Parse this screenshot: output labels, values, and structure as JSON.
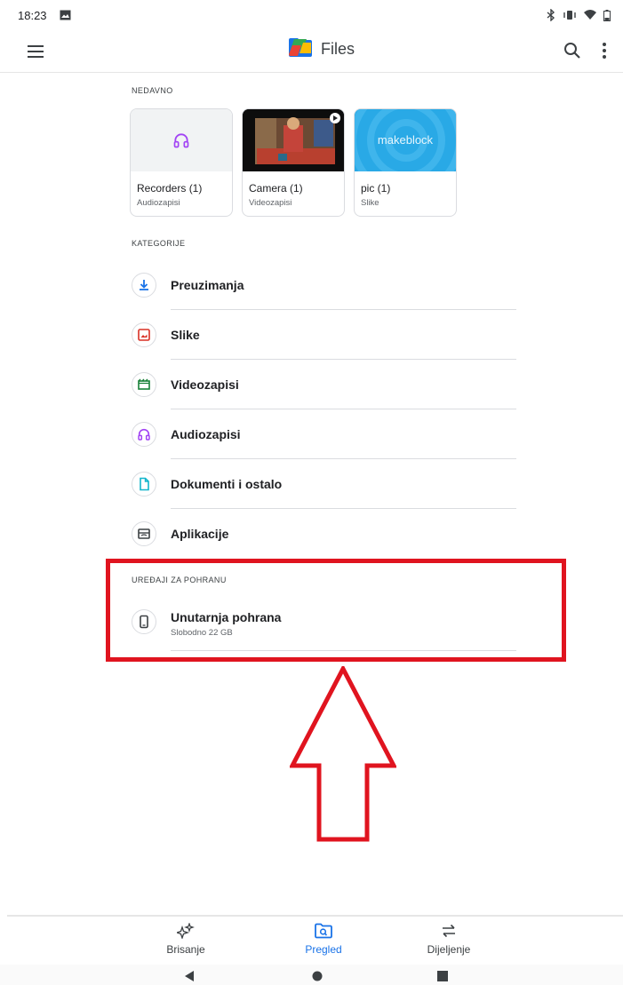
{
  "status_bar": {
    "time": "18:23"
  },
  "app_bar": {
    "title": "Files"
  },
  "recent": {
    "label": "NEDAVNO",
    "cards": [
      {
        "title": "Recorders (1)",
        "subtitle": "Audiozapisi"
      },
      {
        "title": "Camera (1)",
        "subtitle": "Videozapisi"
      },
      {
        "title": "pic (1)",
        "subtitle": "Slike",
        "thumb_text": "makeblock"
      }
    ]
  },
  "categories": {
    "label": "KATEGORIJE",
    "items": [
      {
        "label": "Preuzimanja",
        "icon": "download-icon",
        "color": "#1a73e8"
      },
      {
        "label": "Slike",
        "icon": "image-icon",
        "color": "#d93025"
      },
      {
        "label": "Videozapisi",
        "icon": "video-icon",
        "color": "#188038"
      },
      {
        "label": "Audiozapisi",
        "icon": "headphones-icon",
        "color": "#a142f4"
      },
      {
        "label": "Dokumenti i ostalo",
        "icon": "document-icon",
        "color": "#12b5cb"
      },
      {
        "label": "Aplikacije",
        "icon": "apps-icon",
        "color": "#3c4043"
      }
    ]
  },
  "storage": {
    "label": "UREĐAJI ZA POHRANU",
    "item": {
      "title": "Unutarnja pohrana",
      "subtitle": "Slobodno 22 GB",
      "icon": "phone-icon"
    }
  },
  "bottom_nav": {
    "items": [
      {
        "label": "Brisanje",
        "icon": "sparkle-icon"
      },
      {
        "label": "Pregled",
        "icon": "browse-icon",
        "active": true
      },
      {
        "label": "Dijeljenje",
        "icon": "swap-icon"
      }
    ]
  },
  "colors": {
    "accent": "#1a73e8",
    "highlight": "#e0141f"
  }
}
